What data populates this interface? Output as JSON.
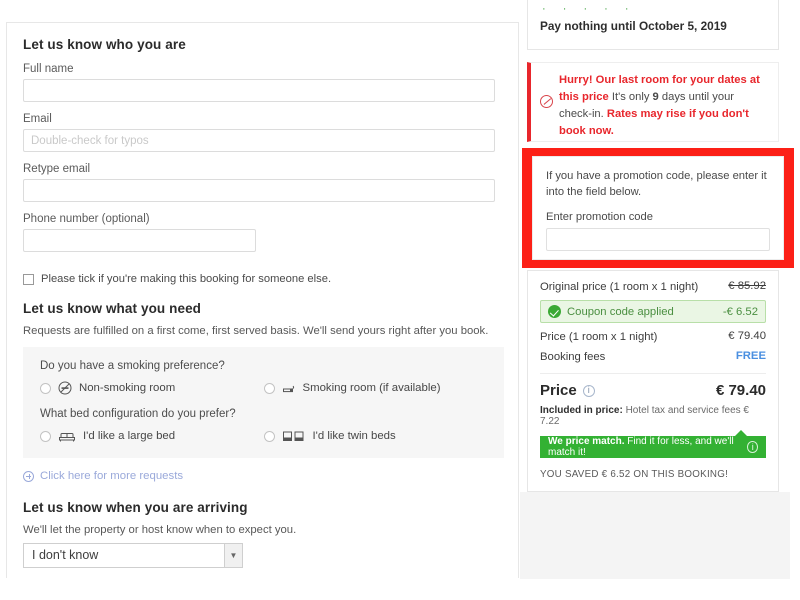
{
  "form": {
    "who_heading": "Let us know who you are",
    "fields": [
      {
        "label": "Full name",
        "value": "",
        "placeholder": ""
      },
      {
        "label": "Email",
        "value": "",
        "placeholder": "Double-check for typos"
      },
      {
        "label": "Retype email",
        "value": "",
        "placeholder": ""
      },
      {
        "label": "Phone number (optional)",
        "value": "",
        "placeholder": ""
      }
    ],
    "someone_else_label": "Please tick if you're making this booking for someone else.",
    "need_heading": "Let us know what you need",
    "need_note": "Requests are fulfilled on a first come, first served basis. We'll send yours right after you book.",
    "smoking_question": "Do you have a smoking preference?",
    "smoking_options": [
      {
        "label": "Non-smoking room",
        "icon": "no-smoking-icon"
      },
      {
        "label": "Smoking room (if available)",
        "icon": "cigarette-icon"
      }
    ],
    "bed_question": "What bed configuration do you prefer?",
    "bed_options": [
      {
        "label": "I'd like a large bed",
        "icon": "double-bed-icon"
      },
      {
        "label": "I'd like twin beds",
        "icon": "twin-beds-icon"
      }
    ],
    "more_requests_link": "Click here for more requests",
    "arriving_heading": "Let us know when you are arriving",
    "arriving_note": "We'll let the property or host know when to expect you.",
    "arrival_select_value": "I don't know"
  },
  "sidebar": {
    "pay_nothing": "Pay nothing until October 5, 2019",
    "alert": {
      "headline": "Hurry! Our last room for your dates at this price",
      "body_pre": "It's only ",
      "days": "9",
      "body_mid": " days until your check-in. ",
      "body_strong": "Rates may rise if you don't book now."
    },
    "promo": {
      "note": "If you have a promotion code, please enter it into the field below.",
      "label": "Enter promotion code",
      "value": "",
      "placeholder": ""
    },
    "price": {
      "original_label": "Original price (1 room x 1 night)",
      "original_value": "€ 85.92",
      "coupon_label": "Coupon code applied",
      "coupon_value": "-€ 6.52",
      "room_label": "Price (1 room x 1 night)",
      "room_value": "€ 79.40",
      "fees_label": "Booking fees",
      "fees_value": "FREE",
      "total_label": "Price",
      "total_value": "€ 79.40",
      "included_bold": "Included in price:",
      "included_rest": " Hotel tax and service fees € 7.22",
      "match_bold": "We price match.",
      "match_rest": " Find it for less, and we'll match it!",
      "saved": "YOU SAVED € 6.52 ON THIS BOOKING!"
    }
  },
  "colors": {
    "alert_red": "#e8262c",
    "highlight_red": "#fc2017",
    "green": "#33b133",
    "coupon_green": "#4b8f41",
    "free_blue": "#4a8fe0",
    "link_blue": "#9aa9da"
  }
}
